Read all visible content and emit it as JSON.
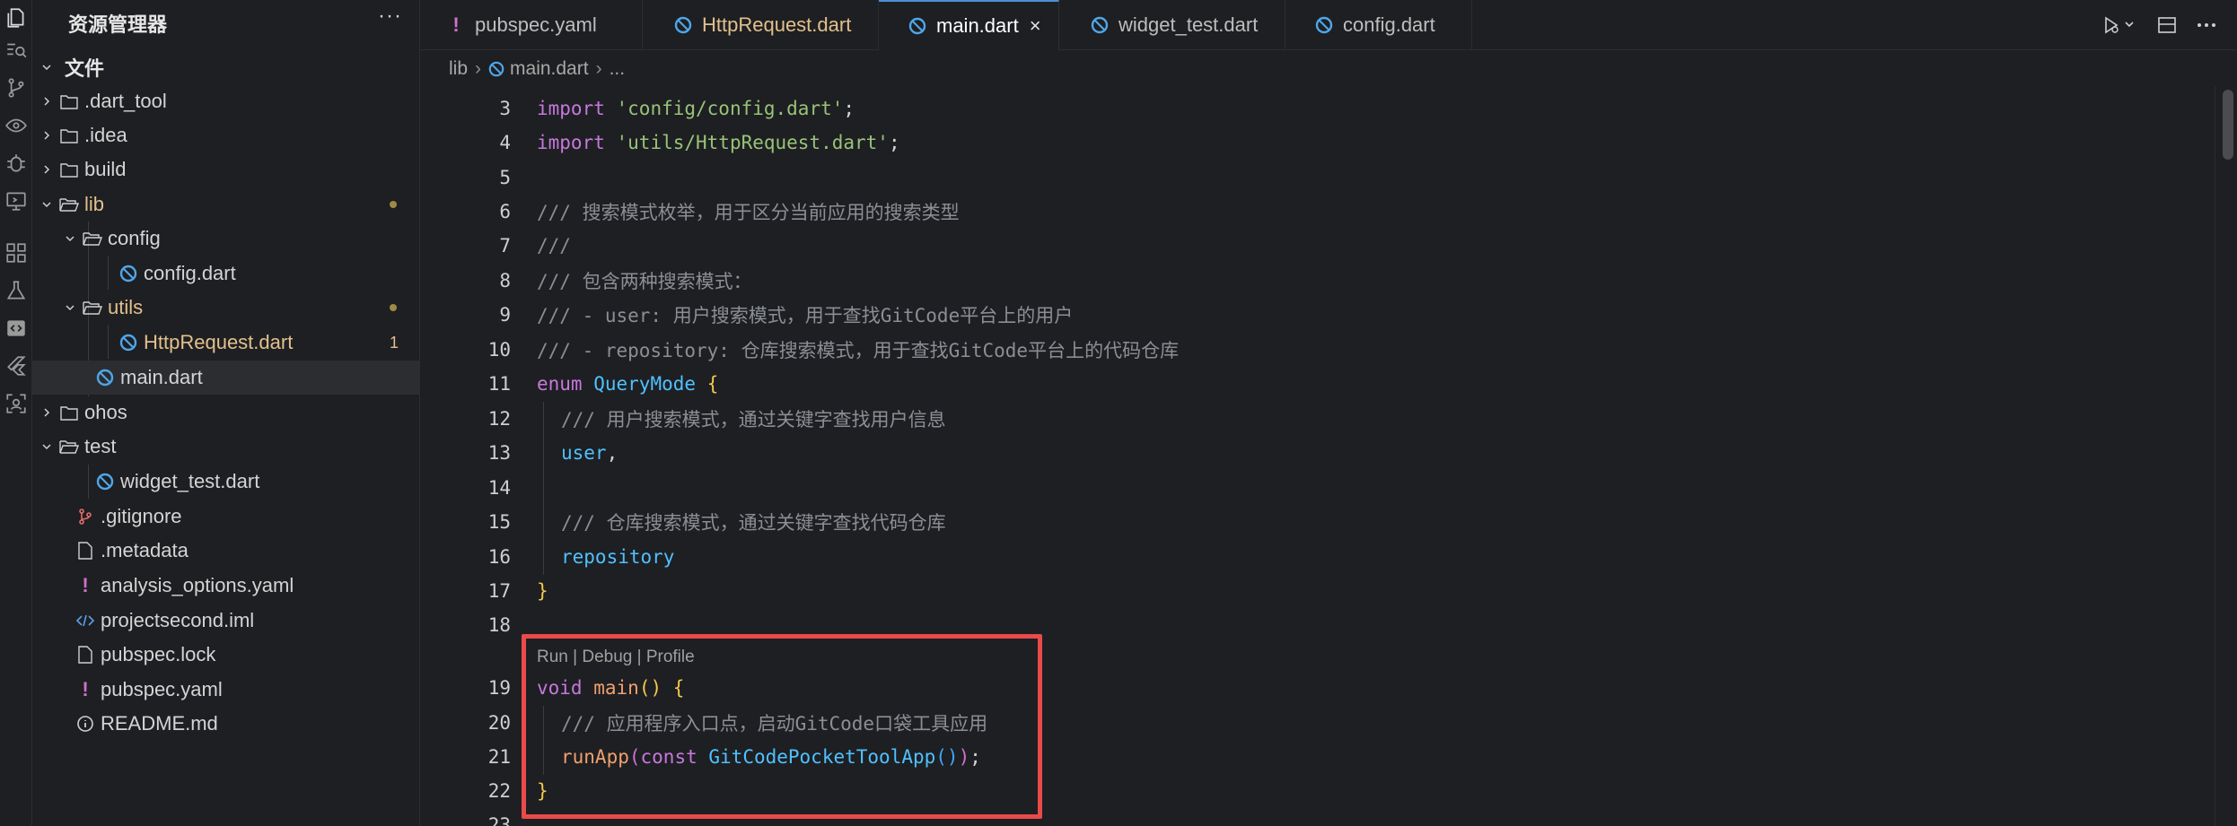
{
  "sidebar": {
    "title": "资源管理器",
    "more": "···",
    "root_label": "文件",
    "items": [
      {
        "label": ".dart_tool"
      },
      {
        "label": ".idea"
      },
      {
        "label": "build"
      },
      {
        "label": "lib"
      },
      {
        "label": "config"
      },
      {
        "label": "config.dart"
      },
      {
        "label": "utils"
      },
      {
        "label": "HttpRequest.dart",
        "badge": "1"
      },
      {
        "label": "main.dart"
      },
      {
        "label": "ohos"
      },
      {
        "label": "test"
      },
      {
        "label": "widget_test.dart"
      },
      {
        "label": ".gitignore"
      },
      {
        "label": ".metadata"
      },
      {
        "label": "analysis_options.yaml"
      },
      {
        "label": "projectsecond.iml"
      },
      {
        "label": "pubspec.lock"
      },
      {
        "label": "pubspec.yaml"
      },
      {
        "label": "README.md"
      }
    ]
  },
  "tabs": [
    {
      "label": "pubspec.yaml",
      "icon": "exclamation-icon"
    },
    {
      "label": "HttpRequest.dart",
      "icon": "dart-icon"
    },
    {
      "label": "main.dart",
      "icon": "dart-icon",
      "close": "×"
    },
    {
      "label": "widget_test.dart",
      "icon": "dart-icon"
    },
    {
      "label": "config.dart",
      "icon": "dart-icon"
    }
  ],
  "breadcrumb": {
    "folder": "lib",
    "file": "main.dart",
    "more": "..."
  },
  "editor": {
    "line_numbers": [
      "3",
      "4",
      "5",
      "6",
      "7",
      "8",
      "9",
      "10",
      "11",
      "12",
      "13",
      "14",
      "15",
      "16",
      "17",
      "18",
      "19",
      "20",
      "21",
      "22",
      "23"
    ],
    "lines": {
      "l3": [
        "import",
        " ",
        "'config/config.dart'",
        ";"
      ],
      "l4": [
        "import",
        " ",
        "'utils/HttpRequest.dart'",
        ";"
      ],
      "l6": "/// 搜索模式枚举，用于区分当前应用的搜索类型",
      "l7": "///",
      "l8": "/// 包含两种搜索模式：",
      "l9": "/// - user: 用户搜索模式，用于查找GitCode平台上的用户",
      "l10": "/// - repository: 仓库搜索模式，用于查找GitCode平台上的代码仓库",
      "l11": [
        "enum",
        " ",
        "QueryMode",
        " ",
        "{"
      ],
      "l12": "/// 用户搜索模式，通过关键字查找用户信息",
      "l13": [
        "user",
        ","
      ],
      "l15": "/// 仓库搜索模式，通过关键字查找代码仓库",
      "l16": "repository",
      "l17": "}",
      "codelens": "Run | Debug | Profile",
      "l19": [
        "void",
        " ",
        "main",
        "()",
        " ",
        "{"
      ],
      "l20": "/// 应用程序入口点，启动GitCode口袋工具应用",
      "l21": [
        "runApp",
        "(",
        "const",
        " ",
        "GitCodePocketToolApp",
        "()",
        ")",
        ";"
      ],
      "l22": "}"
    }
  },
  "colors": {
    "accent": "#4d8ed6",
    "highlight_border": "#e94a4a",
    "modified": "#e2c08d"
  }
}
